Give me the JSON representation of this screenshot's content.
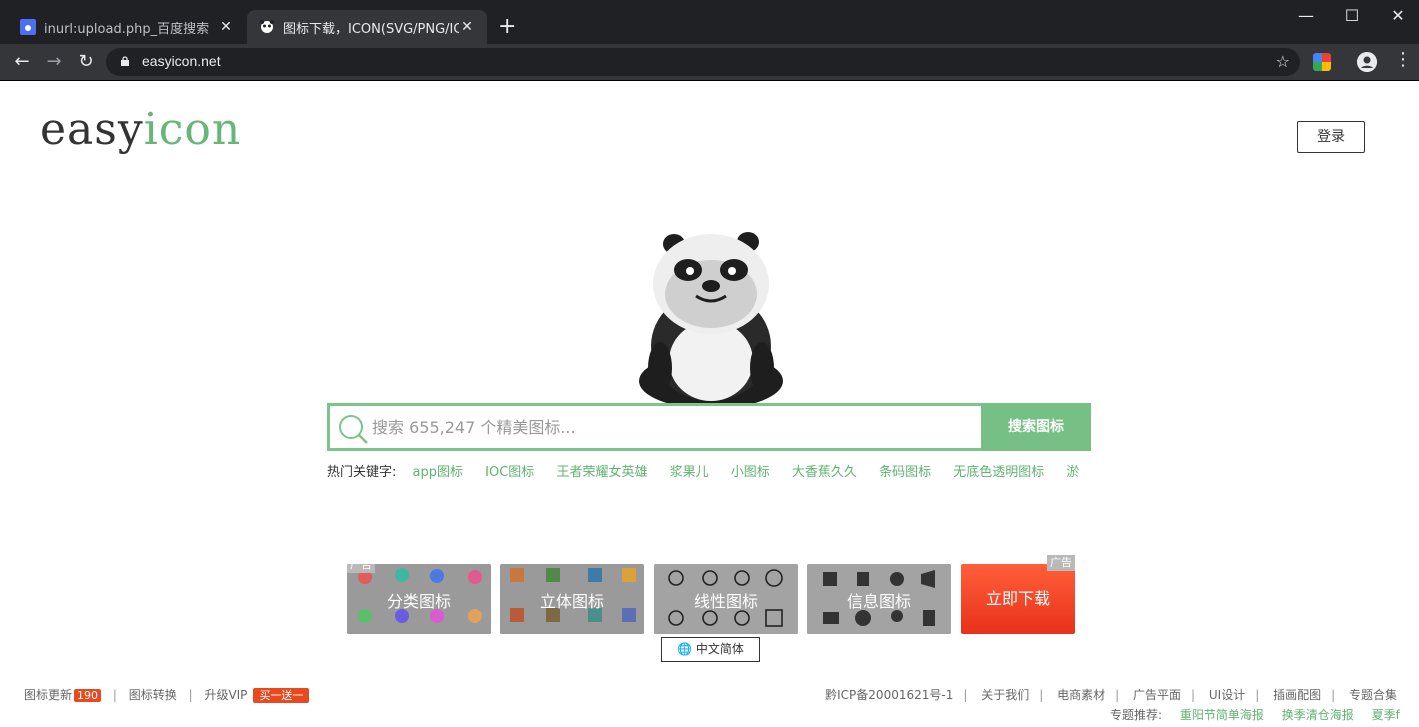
{
  "browser": {
    "tabs": [
      {
        "title": "inurl:upload.php_百度搜索",
        "active": false
      },
      {
        "title": "图标下载，ICON(SVG/PNG/ICO",
        "active": true
      }
    ],
    "url": "easyicon.net"
  },
  "header": {
    "logo_part1": "easy",
    "logo_part2": "icon",
    "login_label": "登录"
  },
  "search": {
    "placeholder": "搜索 655,247 个精美图标...",
    "button_label": "搜索图标"
  },
  "hot": {
    "label": "热门关键字:",
    "keywords": [
      "app图标",
      "IOC图标",
      "王者荣耀女英雄",
      "浆果儿",
      "小图标",
      "大香蕉久久",
      "条码图标",
      "无底色透明图标",
      "淤"
    ]
  },
  "categories": {
    "ad_label": "广告",
    "items": [
      "分类图标",
      "立体图标",
      "线性图标",
      "信息图标"
    ],
    "download_label": "立即下载"
  },
  "language_label": "中文简体",
  "footer": {
    "left": {
      "updates_label": "图标更新",
      "updates_count": "190",
      "convert_label": "图标转换",
      "vip_label": "升级VIP",
      "vip_badge": "买一送一"
    },
    "right": [
      "黔ICP备20001621号-1",
      "关于我们",
      "电商素材",
      "广告平面",
      "UI设计",
      "插画配图",
      "专题合集"
    ],
    "topics_label": "专题推荐:",
    "topics": [
      "重阳节简单海报",
      "换季清仓海报",
      "夏季f"
    ]
  },
  "colors": {
    "accent": "#77c085",
    "link": "#5fb36f",
    "download": "#e8311a"
  }
}
